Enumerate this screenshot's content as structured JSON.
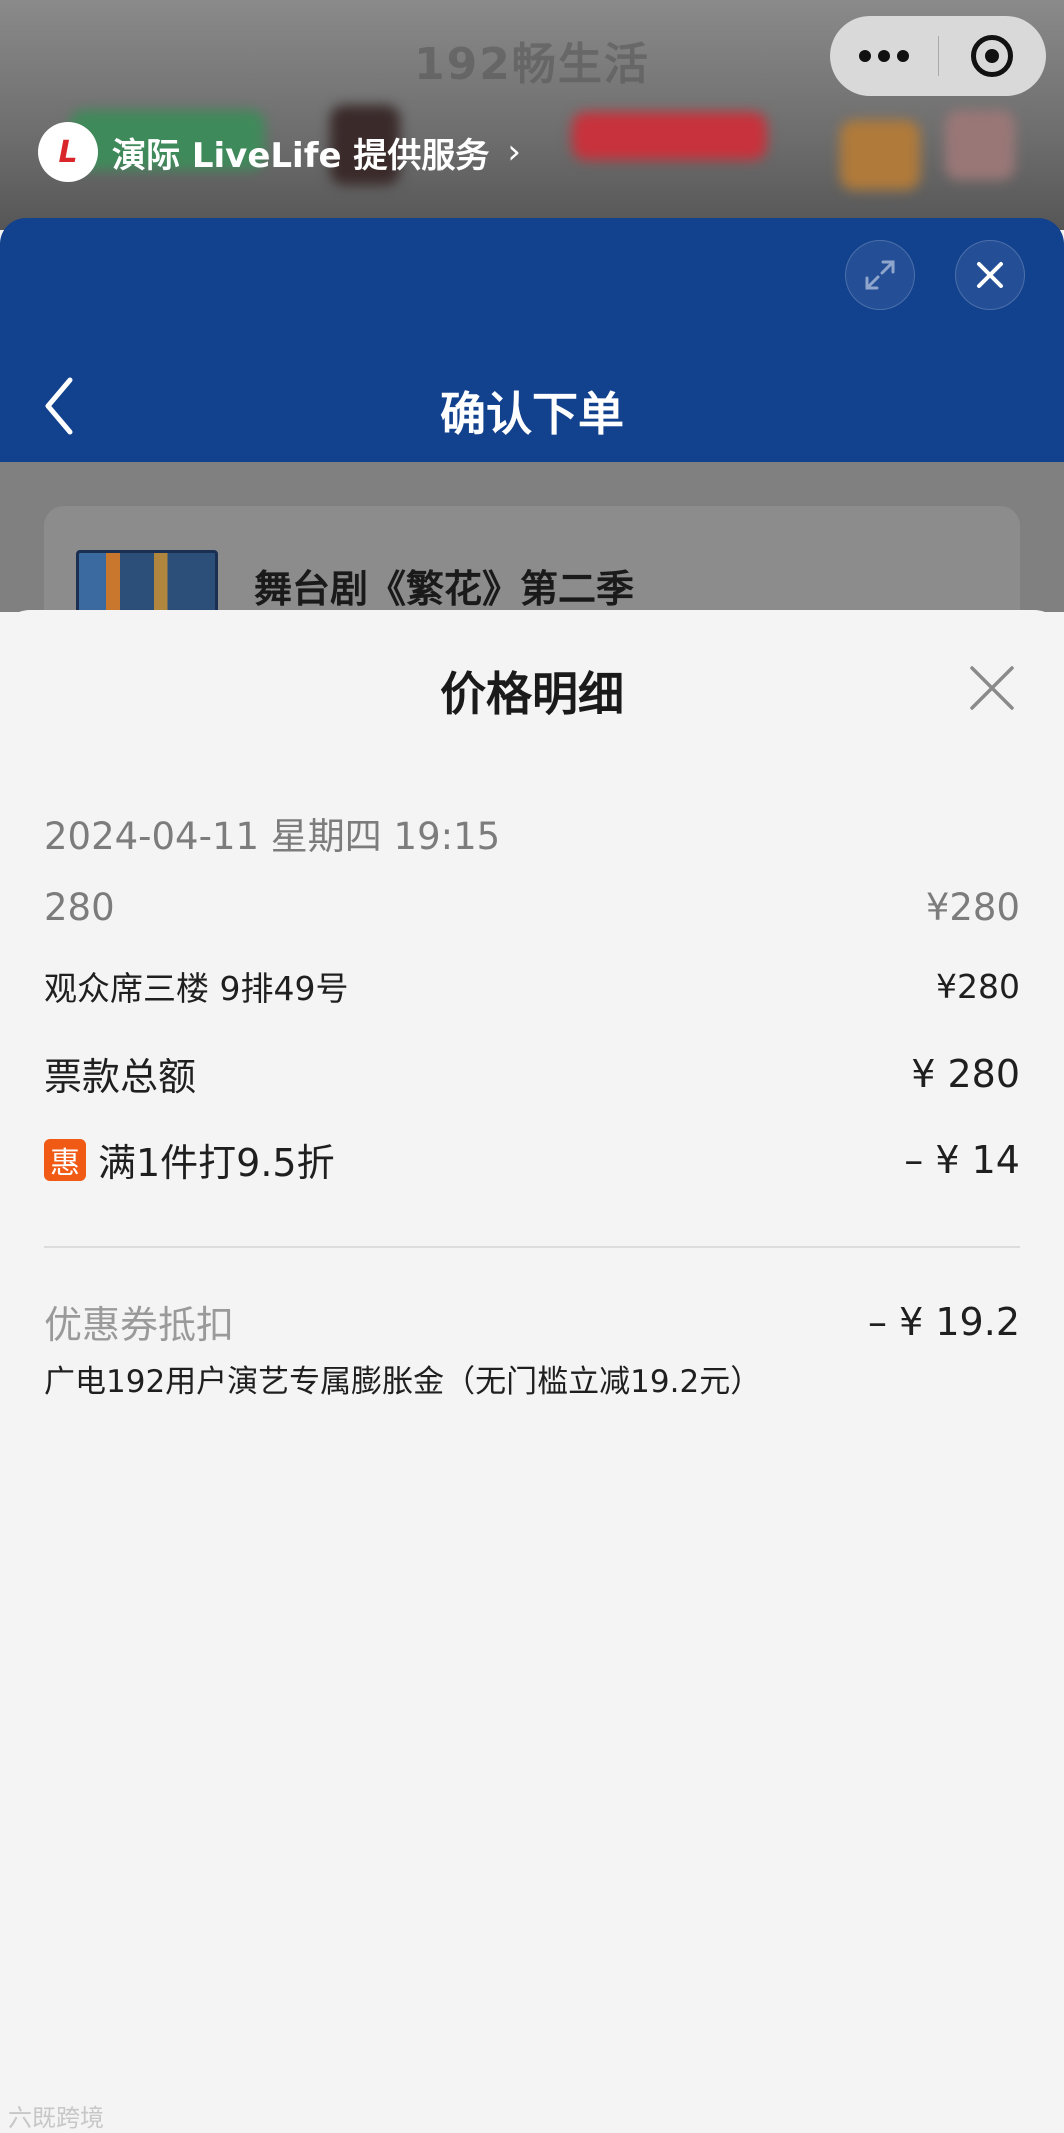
{
  "host": {
    "title": "192畅生活",
    "provider_text": "演际 LiveLife 提供服务",
    "provider_logo": "L"
  },
  "order": {
    "title": "确认下单",
    "product_name": "舞台剧《繁花》第二季"
  },
  "sheet": {
    "title": "价格明细",
    "datetime": "2024-04-11 星期四 19:15",
    "price_tier": "280",
    "price_tier_amount": "¥280",
    "seat": "观众席三楼 9排49号",
    "seat_amount": "¥280",
    "total_label": "票款总额",
    "total_amount": "¥ 280",
    "promo_badge": "惠",
    "promo_label": "满1件打9.5折",
    "promo_amount": "– ¥ 14",
    "coupon_label": "优惠券抵扣",
    "coupon_amount": "– ¥ 19.2",
    "coupon_desc": "广电192用户演艺专属膨胀金（无门槛立减19.2元）"
  },
  "watermark": "六既跨境",
  "colors": {
    "header_blue": "#12418e",
    "promo_orange": "#f05a14"
  }
}
